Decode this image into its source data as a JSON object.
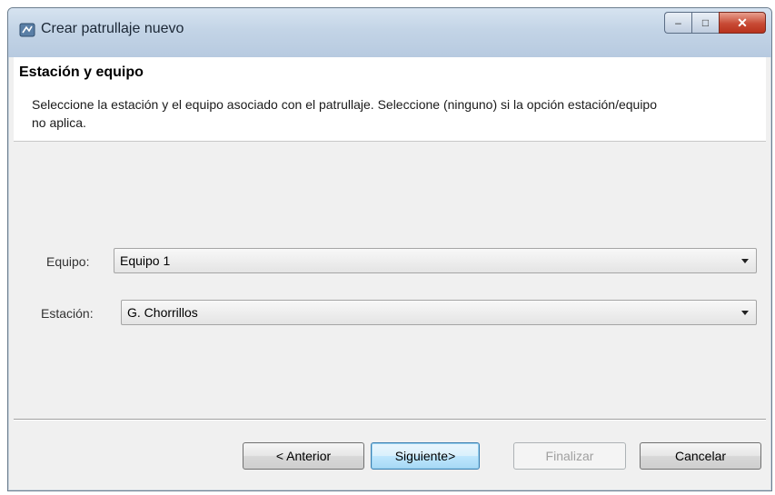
{
  "window": {
    "title": "Crear patrullaje nuevo",
    "controls": {
      "minimize": "–",
      "maximize": "□",
      "close": "✕"
    }
  },
  "header": {
    "title": "Estación y equipo",
    "description": "Seleccione la estación y el equipo asociado con el patrullaje. Seleccione (ninguno) si la opción estación/equipo no aplica."
  },
  "form": {
    "team": {
      "label": "Equipo:",
      "value": "Equipo 1"
    },
    "station": {
      "label": "Estación:",
      "value": "G. Chorrillos"
    }
  },
  "buttons": {
    "back": "< Anterior",
    "next": "Siguiente>",
    "finish": "Finalizar",
    "cancel": "Cancelar"
  },
  "colors": {
    "titlebar": "#c3d4e6",
    "close_button": "#c84a35",
    "default_button_border": "#3c7fb1"
  },
  "icons": {
    "window": "app-window-icon",
    "dropdown": "chevron-down-icon"
  }
}
